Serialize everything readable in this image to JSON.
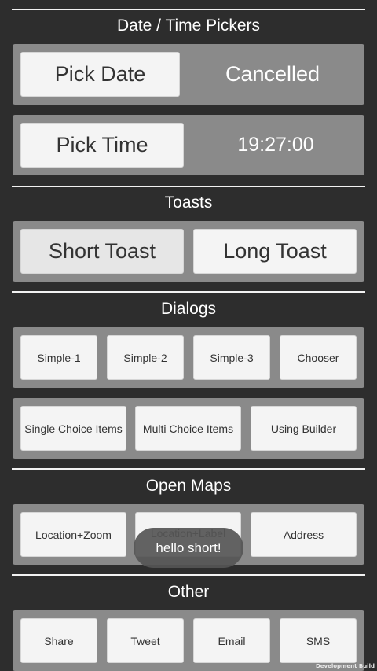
{
  "date_time": {
    "title": "Date / Time Pickers",
    "pick_date_label": "Pick Date",
    "date_value": "Cancelled",
    "pick_time_label": "Pick Time",
    "time_value": "19:27:00"
  },
  "toasts": {
    "title": "Toasts",
    "short_label": "Short Toast",
    "long_label": "Long Toast"
  },
  "dialogs": {
    "title": "Dialogs",
    "simple1_label": "Simple-1",
    "simple2_label": "Simple-2",
    "simple3_label": "Simple-3",
    "chooser_label": "Chooser",
    "single_choice_label": "Single Choice Items",
    "multi_choice_label": "Multi Choice Items",
    "builder_label": "Using Builder"
  },
  "maps": {
    "title": "Open Maps",
    "location_zoom_label": "Location+Zoom",
    "location_label_label": "Location+Label",
    "address_label": "Address"
  },
  "other": {
    "title": "Other",
    "share_label": "Share",
    "tweet_label": "Tweet",
    "email_label": "Email",
    "sms_label": "SMS"
  },
  "toast_message": "hello short!",
  "watermark": "Development Build"
}
